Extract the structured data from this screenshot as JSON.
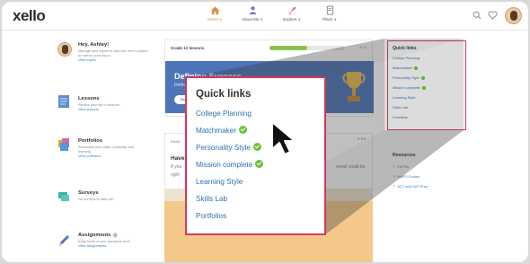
{
  "app": {
    "logo": "xello"
  },
  "nav": [
    {
      "label": "Home ∨",
      "icon": "home-icon",
      "active": true
    },
    {
      "label": "About Me ∨",
      "icon": "person-icon",
      "active": false
    },
    {
      "label": "Explore ∨",
      "icon": "rocket-icon",
      "active": false
    },
    {
      "label": "Plans ∨",
      "icon": "document-icon",
      "active": false
    }
  ],
  "header_icons": [
    "search-icon",
    "heart-icon",
    "avatar"
  ],
  "left": {
    "greeting": {
      "title": "Hey, Ashley!",
      "desc": "Manage your topics to discover more content or narrow your focus.",
      "link": "View topics"
    },
    "lessons": {
      "title": "Lessons",
      "desc": "Review your list of lessons.",
      "link": "View lessons"
    },
    "portfolios": {
      "title": "Portfolios",
      "desc": "Showcase your skills, creativity, and learning.",
      "link": "View portfolios"
    },
    "surveys": {
      "title": "Surveys",
      "desc": "No surveys to take yet!"
    },
    "assignments": {
      "title": "Assignments",
      "badge": "2",
      "desc": "Keep track of your assigned work.",
      "link": "View assignments"
    }
  },
  "main": {
    "grade_label": "Grade 12 lessons",
    "progress_text": "2 / 4",
    "progress": 0.5,
    "banner_title": "Defining Success",
    "banner_sub": "Defin",
    "get_button": "Get",
    "family_label": "Famil",
    "card_heading": "Have",
    "card_line1": "If you",
    "card_line2": "right",
    "card_line3": "onnel could be"
  },
  "quick_links": {
    "title": "Quick links",
    "items": [
      {
        "label": "College Planning",
        "done": false
      },
      {
        "label": "Matchmaker",
        "done": true
      },
      {
        "label": "Personality Style",
        "done": true
      },
      {
        "label": "Mission complete",
        "done": true
      },
      {
        "label": "Learning Style",
        "done": false
      },
      {
        "label": "Skills Lab",
        "done": false
      },
      {
        "label": "Portfolios",
        "done": false
      }
    ]
  },
  "resources": {
    "title": "Resources",
    "items": [
      "FAFSA",
      "MAPS Exams",
      "ACT and SAT Prep"
    ]
  },
  "colors": {
    "accent": "#d4375d",
    "link": "#2c6fb3",
    "check": "#6fbf3b",
    "banner": "#4e74b9"
  }
}
